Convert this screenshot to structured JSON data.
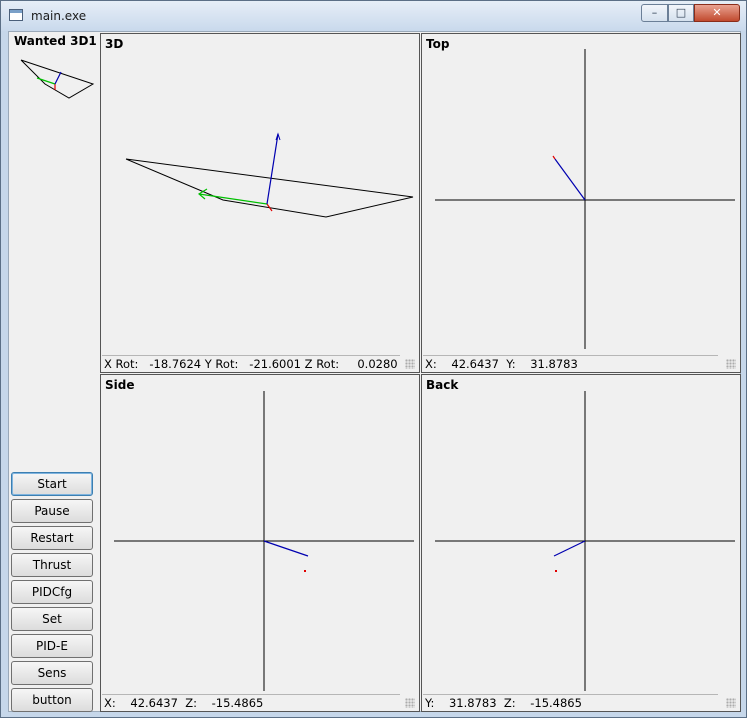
{
  "window": {
    "title": "main.exe",
    "controls": {
      "minimize": "–",
      "maximize": "□",
      "close": "✕"
    }
  },
  "left_panel": {
    "title": "Wanted 3D1",
    "buttons": [
      "Start",
      "Pause",
      "Restart",
      "Thrust",
      "PIDCfg",
      "Set",
      "PID-E",
      "Sens",
      "button"
    ]
  },
  "panes": {
    "view3d": {
      "title": "3D",
      "status": "X Rot:   -18.7624 Y Rot:   -21.6001 Z Rot:     0.0280"
    },
    "top": {
      "title": "Top",
      "status": "X:    42.6437  Y:    31.8783"
    },
    "side": {
      "title": "Side",
      "status": "X:    42.6437  Z:    -15.4865"
    },
    "back": {
      "title": "Back",
      "status": "Y:    31.8783  Z:    -15.4865"
    }
  },
  "colors": {
    "x_axis": "#e00000",
    "y_axis": "#00c000",
    "z_axis": "#0000b0",
    "outline": "#000000"
  }
}
